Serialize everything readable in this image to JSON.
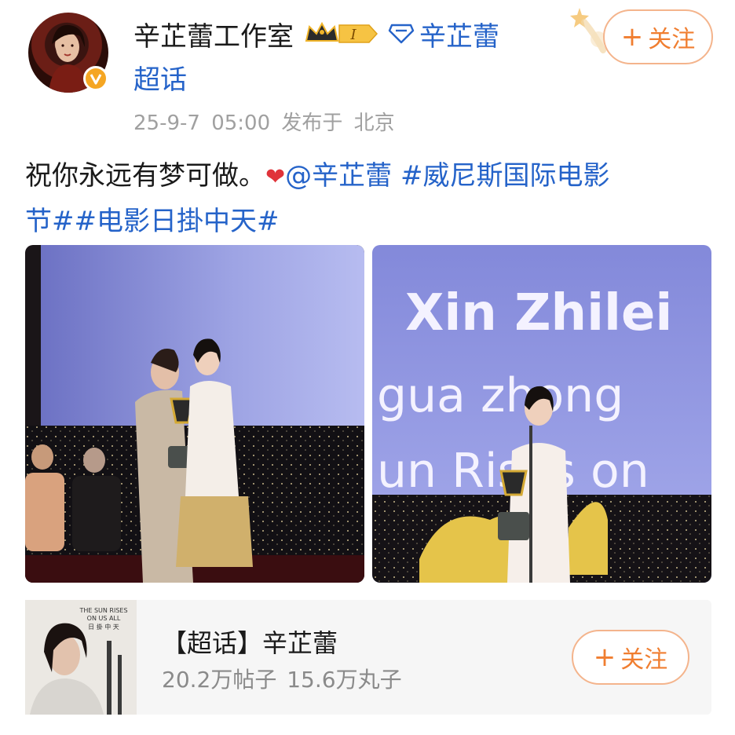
{
  "post": {
    "author": "辛芷蕾工作室",
    "author_rank": "I",
    "linked_name": "辛芷蕾",
    "linked_suffix": "超话",
    "timestamp": "25-9-7 05:00",
    "location": "发布于 北京",
    "follow_label": "关注",
    "text_plain": "祝你永远有梦可做。",
    "mention": "@辛芷蕾",
    "hashtag_1_part_a": "#威尼斯国际电影",
    "hashtag_1_part_b": "节#",
    "hashtag_2": "#电影日掛中天#"
  },
  "photos": {
    "right_screen_line_1": "Xin Zhilei",
    "right_screen_line_2": "gua zhong",
    "right_screen_line_3": "un Rises on"
  },
  "topic_card": {
    "title": "【超话】辛芷蕾",
    "stats": "20.2万帖子 15.6万丸子",
    "follow_label": "关注",
    "poster_line_1": "THE SUN RISES",
    "poster_line_2": "ON US ALL",
    "poster_line_3": "日 掛 中 天"
  },
  "colors": {
    "link": "#2563c9",
    "accent_orange": "#f07e30",
    "heart": "#e0333a",
    "meta_gray": "#a0a0a0"
  },
  "icons": {
    "crown": "crown-rank-badge",
    "diamond": "diamond-icon",
    "verified": "verified-v-icon",
    "heart": "heart-emoji"
  }
}
